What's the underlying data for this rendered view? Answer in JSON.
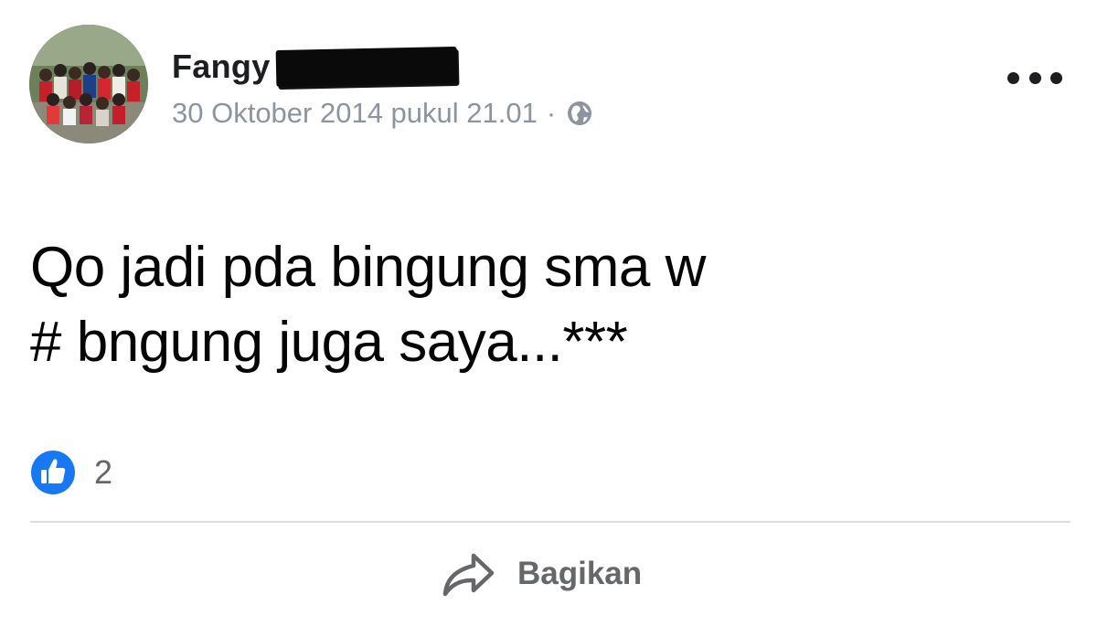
{
  "post": {
    "author_name": "Fangy",
    "timestamp": "30 Oktober 2014 pukul 21.01",
    "separator": "·",
    "privacy_icon": "globe-icon",
    "text_lines": [
      "Qo jadi pda bingung sma w",
      "# bngung juga saya...***"
    ],
    "reaction_count": "2",
    "reaction_icon": "like-icon"
  },
  "actions": {
    "share_label": "Bagikan",
    "share_icon": "share-arrow-icon",
    "more_icon": "more-options-icon"
  },
  "colors": {
    "author": "#1c1e21",
    "meta": "#8d949e",
    "text": "#050505",
    "like_blue": "#1877f2",
    "action_gray": "#65676b",
    "divider": "#dadde1"
  }
}
